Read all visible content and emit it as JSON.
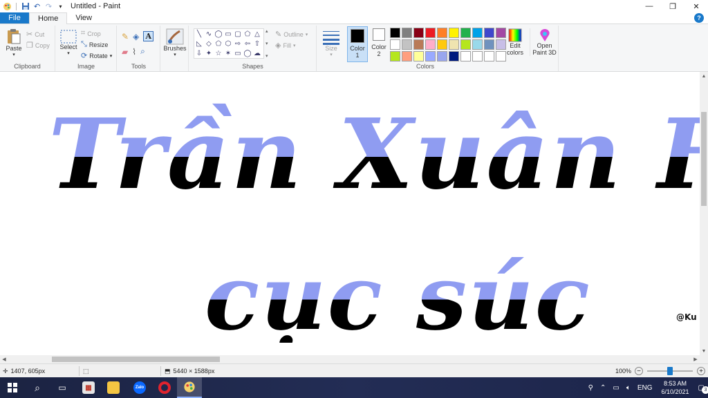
{
  "window": {
    "title": "Untitled - Paint",
    "controls": {
      "minimize": "—",
      "restore": "❐",
      "close": "✕"
    }
  },
  "quick_access": {
    "save_icon": "save-icon",
    "undo_icon": "undo-icon",
    "redo_icon": "redo-icon",
    "customize_icon": "dropdown-icon"
  },
  "tabs": [
    {
      "label": "File"
    },
    {
      "label": "Home"
    },
    {
      "label": "View"
    }
  ],
  "help": {
    "label": "?"
  },
  "ribbon": {
    "clipboard": {
      "label": "Clipboard",
      "paste": "Paste",
      "cut": "Cut",
      "copy": "Copy"
    },
    "image": {
      "label": "Image",
      "select": "Select",
      "crop": "Crop",
      "resize": "Resize",
      "rotate": "Rotate"
    },
    "tools": {
      "label": "Tools"
    },
    "brushes": {
      "label": "Brushes"
    },
    "shapes": {
      "label": "Shapes",
      "outline": "Outline",
      "fill": "Fill",
      "glyphs": [
        "╲",
        "∿",
        "◯",
        "▭",
        "▢",
        "⬠",
        "△",
        "◺",
        "◇",
        "⬠",
        "⬡",
        "⇨",
        "⇦",
        "⇧",
        "⇩",
        "✦",
        "☆",
        "✶",
        "▭",
        "◯",
        "☁"
      ]
    },
    "size": {
      "label": "Size"
    },
    "colors": {
      "label": "Colors",
      "color1": "Color",
      "color1_num": "1",
      "color2": "Color",
      "color2_num": "2",
      "edit_colors": "Edit colors",
      "open_paint3d": "Open Paint 3D",
      "palette": [
        "#000000",
        "#7f7f7f",
        "#880015",
        "#ed1c24",
        "#ff7f27",
        "#fff200",
        "#22b14c",
        "#00a2e8",
        "#3f48cc",
        "#a349a4",
        "#ffffff",
        "#c3c3c3",
        "#b97a57",
        "#ffaec9",
        "#ffc90e",
        "#efe4b0",
        "#b5e61d",
        "#99d9ea",
        "#7092be",
        "#c8bfe7",
        "#b5e61d",
        "#ff9f7f",
        "#ffff99",
        "#99aaff",
        "#99a6ee",
        "#001a7f",
        "#ffffff",
        "#ffffff",
        "#ffffff",
        "#ffffff"
      ]
    }
  },
  "canvas": {
    "line1": "Trần Xuân Hoa",
    "line2": "cục súc",
    "signature": "@Ku"
  },
  "status": {
    "cursor_pos": "1407, 605px",
    "image_size": "5440 × 1588px",
    "zoom": "100%",
    "zoom_out": "−",
    "zoom_in": "+"
  },
  "taskbar": {
    "language": "ENG",
    "time": "8:53 AM",
    "date": "6/10/2021",
    "notifications": "3",
    "zalo_label": "Zalo"
  }
}
